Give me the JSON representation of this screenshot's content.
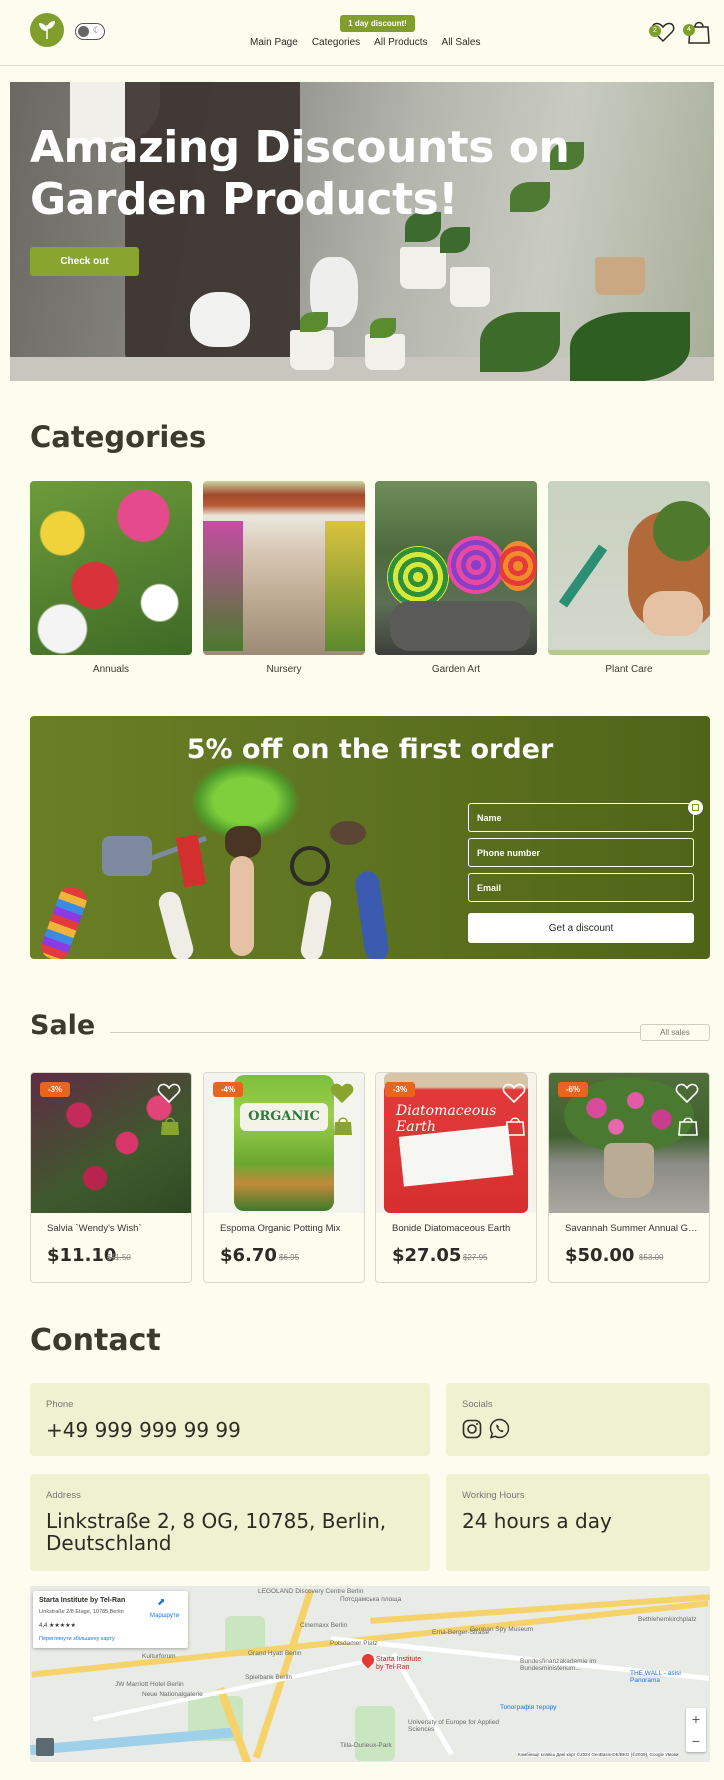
{
  "header": {
    "badge": "1 day discount!",
    "nav": [
      "Main Page",
      "Categories",
      "All Products",
      "All Sales"
    ],
    "favorites_count": "2",
    "cart_count": "4",
    "brand_color": "#7f9e2c"
  },
  "hero": {
    "title_line1": "Amazing Discounts on",
    "title_line2": "Garden Products!",
    "button": "Check out"
  },
  "categories": {
    "title": "Categories",
    "items": [
      {
        "label": "Annuals"
      },
      {
        "label": "Nursery"
      },
      {
        "label": "Garden Art"
      },
      {
        "label": "Plant Care"
      }
    ]
  },
  "promo": {
    "title": "5% off on the first order",
    "name_placeholder": "Name",
    "phone_placeholder": "Phone number",
    "email_placeholder": "Email",
    "button": "Get a discount"
  },
  "sale": {
    "title": "Sale",
    "all_button": "All sales",
    "products": [
      {
        "discount": "-3%",
        "name": "Salvia `Wendy's Wish`",
        "price": "$11.10",
        "old_price": "$11.50"
      },
      {
        "discount": "-4%",
        "name": "Espoma Organic Potting Mix",
        "price": "$6.70",
        "old_price": "$6.95"
      },
      {
        "discount": "-3%",
        "name": "Bonide Diatomaceous Earth",
        "price": "$27.05",
        "old_price": "$27.95"
      },
      {
        "discount": "-6%",
        "name": "Savannah Summer Annual Garden",
        "price": "$50.00",
        "old_price": "$53.00"
      }
    ]
  },
  "contact": {
    "title": "Contact",
    "phone_label": "Phone",
    "phone": "+49 999 999 99 99",
    "socials_label": "Socials",
    "address_label": "Address",
    "address_line1": "Linkstraße 2, 8 OG, 10785, Berlin,",
    "address_line2": "Deutschland",
    "hours_label": "Working Hours",
    "hours": "24 hours a day"
  },
  "map": {
    "place": "Starta Institute by Tel-Ran",
    "address": "Linkstraße 2/8 Etage, 10785 Berlin",
    "rating": "4,4 ★★★★★",
    "directions": "Маршрути",
    "larger_map": "Переглянути збільшену карту",
    "pin_label_1": "Starta Institute",
    "pin_label_2": "by Tel-Ran",
    "labels": [
      "LEGOLAND Discovery Centre Berlin",
      "Потсдамська площа",
      "German Spy Museum",
      "Cinemaxx Berlin",
      "Potsdamer Platz",
      "Kulturforum",
      "Grand Hyatt Berlin",
      "JW Marriott Hotel Berlin",
      "Neue Nationalgalerie",
      "Spielbank Berlin",
      "Bundesfinanzakademie im Bundesministerium...",
      "THE WALL - asisi Panorama",
      "Топографія терору",
      "Tilla-Durieux-Park",
      "University of Europe for Applied Sciences",
      "Bethlehemkirchplatz",
      "Erna-Berger-Straße"
    ],
    "attribution": "Комбінації клавіш  Дані карт ©2024 GeoBasis-DE/BKG (©2009), Google  Умови"
  }
}
